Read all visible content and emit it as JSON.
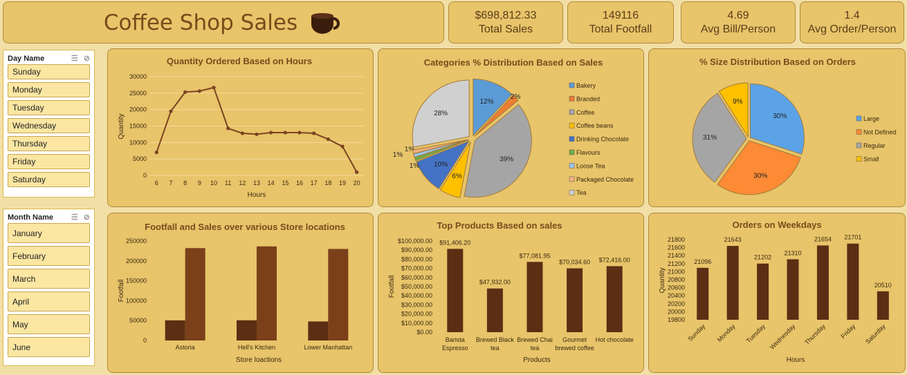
{
  "header": {
    "title": "Coffee Shop Sales",
    "icon": "coffee-cup-icon"
  },
  "kpis": [
    {
      "value": "$698,812.33",
      "label": "Total Sales"
    },
    {
      "value": "149116",
      "label": "Total Footfall"
    },
    {
      "value": "4.69",
      "label": "Avg Bill/Person"
    },
    {
      "value": "1.4",
      "label": "Avg Order/Person"
    }
  ],
  "slicers": {
    "day": {
      "title": "Day Name",
      "items": [
        "Sunday",
        "Monday",
        "Tuesday",
        "Wednesday",
        "Thursday",
        "Friday",
        "Saturday"
      ]
    },
    "month": {
      "title": "Month Name",
      "items": [
        "January",
        "February",
        "March",
        "April",
        "May",
        "June"
      ]
    }
  },
  "colors": {
    "dark_brown": "#5a2f14",
    "mid_brown": "#7b4019",
    "line": "#7b4321"
  },
  "chart_data": [
    {
      "id": "hours",
      "type": "line",
      "title": "Quantity Ordered Based on Hours",
      "xlabel": "Hours",
      "ylabel": "Quantity",
      "x": [
        "6",
        "7",
        "8",
        "9",
        "10",
        "11",
        "12",
        "13",
        "14",
        "15",
        "16",
        "17",
        "18",
        "19",
        "20"
      ],
      "values": [
        7000,
        19500,
        25300,
        25600,
        26700,
        14300,
        12800,
        12500,
        13000,
        13000,
        13000,
        12800,
        11000,
        8800,
        1000
      ],
      "ylim": [
        0,
        30000
      ],
      "yticks": [
        "0",
        "5000",
        "10000",
        "15000",
        "20000",
        "25000",
        "30000"
      ],
      "grid": true
    },
    {
      "id": "categories",
      "type": "pie",
      "title": "Categories % Distribution Based on Sales",
      "labels": [
        "Bakery",
        "Branded",
        "Coffee",
        "Coffee beans",
        "Drinking Chocolate",
        "Flavours",
        "Loose Tea",
        "Packaged Chocolate",
        "Tea"
      ],
      "values": [
        12,
        2,
        39,
        6,
        10,
        1,
        1,
        1,
        28
      ],
      "data_labels": [
        "12%",
        "2%",
        "39%",
        "6%",
        "10%",
        "1%",
        "1%",
        "1%",
        "28%"
      ],
      "colors": [
        "#5b9bd5",
        "#ed7d31",
        "#a5a5a5",
        "#ffc000",
        "#4472c4",
        "#70ad47",
        "#9dc3e6",
        "#f4b183",
        "#d0d0d0"
      ],
      "legend": "right"
    },
    {
      "id": "sizes",
      "type": "pie",
      "title": "% Size Distribution Based on Orders",
      "labels": [
        "Large",
        "Not Defined",
        "Regular",
        "Small"
      ],
      "values": [
        30,
        30,
        31,
        9
      ],
      "data_labels": [
        "30%",
        "30%",
        "31%",
        "9%"
      ],
      "colors": [
        "#5ba3e6",
        "#fd8a34",
        "#a5a5a5",
        "#ffc000"
      ],
      "legend": "right"
    },
    {
      "id": "locations",
      "type": "bar",
      "title": "Footfall and Sales over various Store locations",
      "xlabel": "Store loactions",
      "ylabel": "Footfall",
      "categories": [
        "Astoria",
        "Hell's Kitchen",
        "Lower Manhattan"
      ],
      "series": [
        {
          "values": [
            50600,
            50700,
            47800
          ]
        },
        {
          "values": [
            232200,
            236500,
            230100
          ]
        }
      ],
      "ylim": [
        0,
        250000
      ],
      "yticks": [
        "0",
        "50000",
        "100000",
        "150000",
        "200000",
        "250000"
      ]
    },
    {
      "id": "products",
      "type": "bar",
      "title": "Top Products Based on sales",
      "xlabel": "Products",
      "ylabel": "Footfall",
      "categories": [
        [
          "Barista",
          "Espresso"
        ],
        [
          "Brewed Black",
          "tea"
        ],
        [
          "Brewed Chai",
          "tea"
        ],
        [
          "Gourmet",
          "brewed coffee"
        ],
        [
          "Hot chocolate"
        ]
      ],
      "values": [
        91406.2,
        47932.0,
        77081.95,
        70034.6,
        72416.0
      ],
      "data_labels": [
        "$91,406.20",
        "$47,932.00",
        "$77,081.95",
        "$70,034.60",
        "$72,416.00"
      ],
      "ylim": [
        0,
        100000
      ],
      "yticks": [
        "$0.00",
        "$10,000.00",
        "$20,000.00",
        "$30,000.00",
        "$40,000.00",
        "$50,000.00",
        "$60,000.00",
        "$70,000.00",
        "$80,000.00",
        "$90,000.00",
        "$100,000.00"
      ]
    },
    {
      "id": "weekdays",
      "type": "bar",
      "title": "Orders on Weekdays",
      "xlabel": "Hours",
      "ylabel": "Quantity",
      "categories": [
        "Sunday",
        "Monday",
        "Tuesday",
        "Wednesday",
        "Thursday",
        "Friday",
        "Saturday"
      ],
      "values": [
        21096,
        21643,
        21202,
        21310,
        21654,
        21701,
        20510
      ],
      "data_labels": [
        "21096",
        "21643",
        "21202",
        "21310",
        "21654",
        "21701",
        "20510"
      ],
      "ylim": [
        19800,
        21800
      ],
      "yticks": [
        "19800",
        "20000",
        "20200",
        "20400",
        "20600",
        "20800",
        "21000",
        "21200",
        "21400",
        "21600",
        "21800"
      ]
    }
  ]
}
